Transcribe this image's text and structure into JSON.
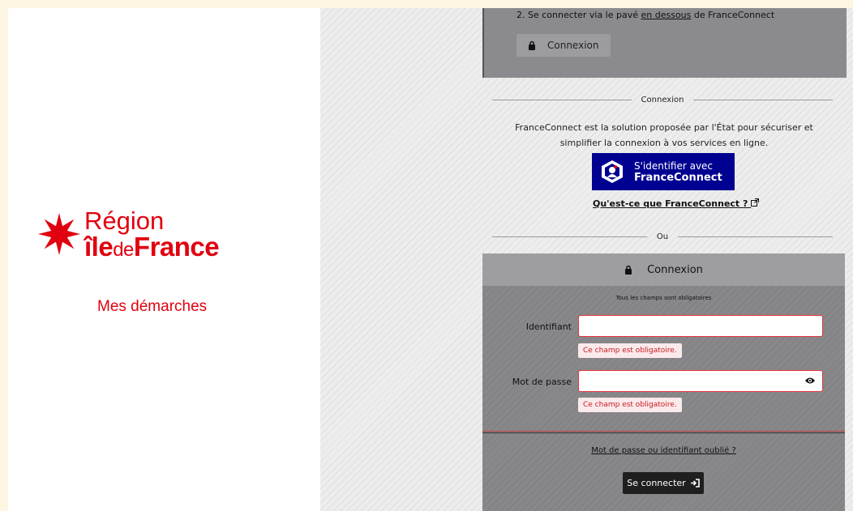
{
  "brand": {
    "line1": "Région",
    "line2_a": "île",
    "line2_b": "de",
    "line2_c": "France",
    "subtitle": "Mes démarches",
    "color": "#e1000f"
  },
  "top_box": {
    "step_prefix": "2. Se connecter via le pavé ",
    "step_link": "en dessous",
    "step_suffix": " de FranceConnect",
    "button_label": "Connexion",
    "button_icon": "lock-icon"
  },
  "separator_connexion": "Connexion",
  "franceconnect": {
    "description": "FranceConnect est la solution proposée par l'État pour sécuriser et simplifier la connexion à vos services en ligne.",
    "button_line1": "S'identifier avec",
    "button_line2": "FranceConnect",
    "info_link": "Qu'est-ce que FranceConnect ?",
    "button_color": "#000091"
  },
  "separator_ou": "Ou",
  "login": {
    "title": "Connexion",
    "required_note": "Tous les champs sont obligatoires",
    "username_label": "Identifiant",
    "username_value": "",
    "username_error": "Ce champ est obligatoire.",
    "password_label": "Mot de passe",
    "password_value": "",
    "password_error": "Ce champ est obligatoire.",
    "forgot_link": "Mot de passe ou identifiant oublié ?",
    "submit_label": "Se connecter"
  }
}
